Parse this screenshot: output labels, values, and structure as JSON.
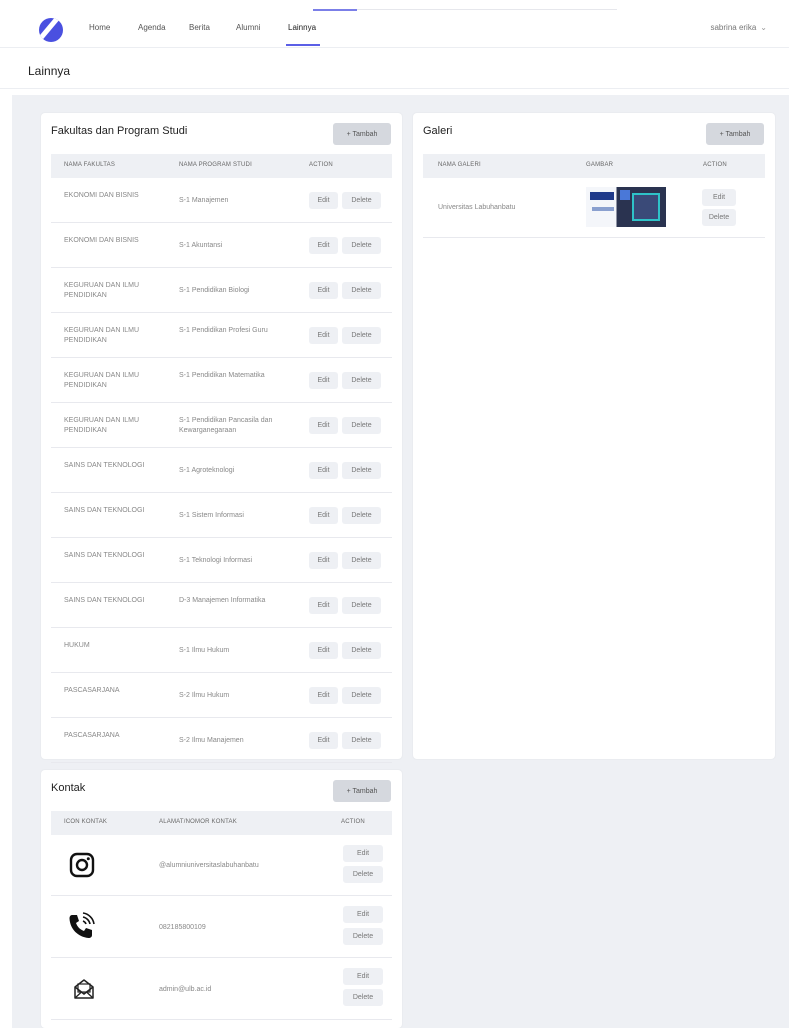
{
  "nav": {
    "items": [
      "Home",
      "Agenda",
      "Berita",
      "Alumni",
      "Lainnya"
    ],
    "active": "Lainnya",
    "user_name": "sabrina erika"
  },
  "page_title": "Lainnya",
  "fakultas": {
    "title": "Fakultas dan Program Studi",
    "add_label": "+ Tambah",
    "columns": [
      "NAMA FAKULTAS",
      "NAMA PROGRAM STUDI",
      "ACTION"
    ],
    "rows": [
      {
        "fakultas": "EKONOMI DAN BISNIS",
        "prodi": "S-1 Manajemen"
      },
      {
        "fakultas": "EKONOMI DAN BISNIS",
        "prodi": "S-1 Akuntansi"
      },
      {
        "fakultas": "KEGURUAN DAN ILMU PENDIDIKAN",
        "prodi": "S-1 Pendidikan Biologi"
      },
      {
        "fakultas": "KEGURUAN DAN ILMU PENDIDIKAN",
        "prodi": "S-1 Pendidikan Profesi Guru"
      },
      {
        "fakultas": "KEGURUAN DAN ILMU PENDIDIKAN",
        "prodi": "S-1 Pendidikan Matematika"
      },
      {
        "fakultas": "KEGURUAN DAN ILMU PENDIDIKAN",
        "prodi": "S-1 Pendidikan Pancasila dan Kewarganegaraan"
      },
      {
        "fakultas": "SAINS DAN TEKNOLOGI",
        "prodi": "S-1 Agroteknologi"
      },
      {
        "fakultas": "SAINS DAN TEKNOLOGI",
        "prodi": "S-1 Sistem Informasi"
      },
      {
        "fakultas": "SAINS DAN TEKNOLOGI",
        "prodi": "S-1 Teknologi Informasi"
      },
      {
        "fakultas": "SAINS DAN TEKNOLOGI",
        "prodi": "D-3 Manajemen Informatika"
      },
      {
        "fakultas": "HUKUM",
        "prodi": "S-1 Ilmu Hukum"
      },
      {
        "fakultas": "PASCASARJANA",
        "prodi": "S-2 Ilmu Hukum"
      },
      {
        "fakultas": "PASCASARJANA",
        "prodi": "S-2 Ilmu Manajemen"
      }
    ],
    "edit_label": "Edit",
    "delete_label": "Delete"
  },
  "galeri": {
    "title": "Galeri",
    "add_label": "+ Tambah",
    "columns": [
      "NAMA GALERI",
      "GAMBAR",
      "ACTION"
    ],
    "rows": [
      {
        "nama": "Universitas Labuhanbatu",
        "icon": "campus-photo"
      }
    ],
    "edit_label": "Edit",
    "delete_label": "Delete"
  },
  "kontak": {
    "title": "Kontak",
    "add_label": "+ Tambah",
    "columns": [
      "ICON KONTAK",
      "ALAMAT/NOMOR KONTAK",
      "ACTION"
    ],
    "rows": [
      {
        "icon": "instagram-icon",
        "value": "@alumniuniversitaslabuhanbatu"
      },
      {
        "icon": "phone-icon",
        "value": "082185800109"
      },
      {
        "icon": "mail-icon",
        "value": "admin@ulb.ac.id"
      }
    ],
    "edit_label": "Edit",
    "delete_label": "Delete"
  },
  "colors": {
    "accent": "#5b5fe6",
    "logo": "#4a50e0",
    "panel_bg": "#eef0f4"
  }
}
